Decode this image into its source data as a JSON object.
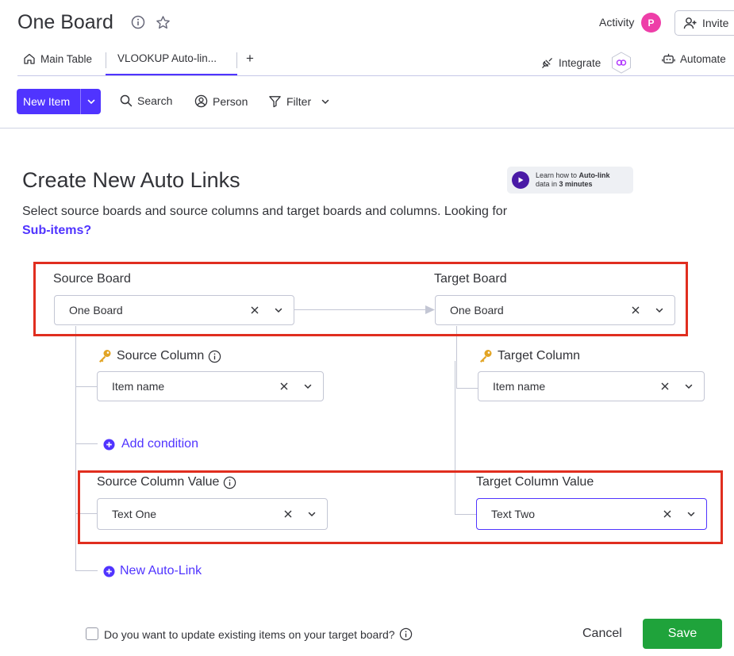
{
  "header": {
    "board_title": "One Board",
    "activity_label": "Activity",
    "avatar_initial": "P",
    "invite_label": "Invite"
  },
  "tabs": [
    {
      "label": "Main Table",
      "icon": "home-icon"
    },
    {
      "label": "VLOOKUP Auto-lin...",
      "active": true
    }
  ],
  "add_tab_label": "+",
  "header_actions": {
    "integrate_label": "Integrate",
    "automate_label": "Automate"
  },
  "toolbar": {
    "new_item_label": "New Item",
    "search_label": "Search",
    "person_label": "Person",
    "filter_label": "Filter"
  },
  "page": {
    "heading": "Create New Auto Links",
    "description": "Select source boards and source columns and target boards and columns. Looking for ",
    "subitems_link": "Sub-items?",
    "video_card_line1_prefix": "Learn how to ",
    "video_card_line1_bold": "Auto-link",
    "video_card_line2_prefix": "data in ",
    "video_card_line2_bold": "3 minutes"
  },
  "form": {
    "source_board_label": "Source Board",
    "source_board_value": "One Board",
    "target_board_label": "Target Board",
    "target_board_value": "One Board",
    "source_column_label": "Source Column",
    "source_column_value": "Item name",
    "target_column_label": "Target Column",
    "target_column_value": "Item name",
    "add_condition_label": "Add condition",
    "source_column_value_label": "Source Column Value",
    "source_column_value_value": "Text One",
    "target_column_value_label": "Target Column Value",
    "target_column_value_value": "Text Two",
    "new_auto_link_label": "New Auto-Link"
  },
  "footer": {
    "update_existing_label": "Do you want to update existing items on your target board?",
    "update_existing_checked": false,
    "cancel_label": "Cancel",
    "save_label": "Save"
  },
  "colors": {
    "primary": "#5034ff",
    "save_green": "#1fa33b",
    "highlight_red": "#e02e1f",
    "avatar_pink": "#ee3ea8"
  }
}
